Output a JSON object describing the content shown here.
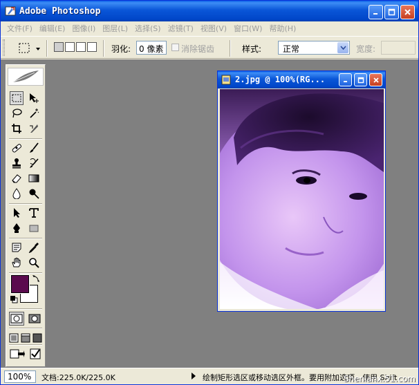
{
  "app": {
    "title": "Adobe Photoshop"
  },
  "menu": {
    "items": [
      "文件(F)",
      "编辑(E)",
      "图像(I)",
      "图层(L)",
      "选择(S)",
      "滤镜(T)",
      "视图(V)",
      "窗口(W)",
      "帮助(H)"
    ]
  },
  "options": {
    "feather_label": "羽化:",
    "feather_value": "0 像素",
    "antialias_label": "消除锯齿",
    "style_label": "样式:",
    "style_value": "正常",
    "width_label": "宽度:"
  },
  "colors": {
    "foreground": "#5a0a4e",
    "background": "#ffffff",
    "workspace": "#808080"
  },
  "toolbox": {
    "tools": [
      "rectangular-marquee",
      "move",
      "lasso",
      "magic-wand",
      "crop",
      "slice",
      "healing-brush",
      "brush",
      "clone-stamp",
      "history-brush",
      "eraser",
      "gradient",
      "blur",
      "dodge",
      "path-selection",
      "type",
      "pen",
      "shape",
      "notes",
      "eyedropper",
      "hand",
      "zoom"
    ]
  },
  "document": {
    "title": "2.jpg @ 100%(RG..."
  },
  "status": {
    "zoom": "100%",
    "doc_size": "文档:225.0K/225.0K",
    "hint": "绘制矩形选区或移动选区外框。要用附加选项，使用 Shift",
    "watermark": "Shenlanx.51.com"
  }
}
